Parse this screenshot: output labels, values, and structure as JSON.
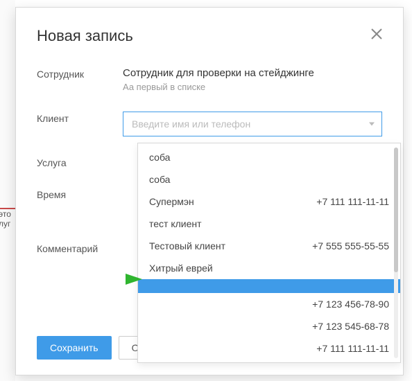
{
  "modal": {
    "title": "Новая запись"
  },
  "fields": {
    "employee_label": "Сотрудник",
    "employee_value": "Сотрудник для проверки на стейджинге",
    "employee_sub": "Аа первый в списке",
    "client_label": "Клиент",
    "client_placeholder": "Введите имя или телефон",
    "service_label": "Услуга",
    "time_label": "Время",
    "comment_label": "Комментарий"
  },
  "dropdown": {
    "items": [
      {
        "name": "соба",
        "phone": ""
      },
      {
        "name": "соба",
        "phone": ""
      },
      {
        "name": "Супермэн",
        "phone": "+7 111 111-11-11"
      },
      {
        "name": "тест клиент",
        "phone": ""
      },
      {
        "name": "Тестовый клиент",
        "phone": "+7 555 555-55-55"
      },
      {
        "name": "Хитрый еврей",
        "phone": ""
      },
      {
        "name": "",
        "phone": "",
        "selected": true
      },
      {
        "name": "",
        "phone": "+7 123 456-78-90"
      },
      {
        "name": "",
        "phone": "+7 123 545-68-78"
      },
      {
        "name": "",
        "phone": "+7 111 111-11-11"
      }
    ]
  },
  "footer": {
    "save_label": "Сохранить",
    "cancel_label": "Отменить"
  },
  "bg": {
    "t1": "это",
    "t2": "луг"
  }
}
